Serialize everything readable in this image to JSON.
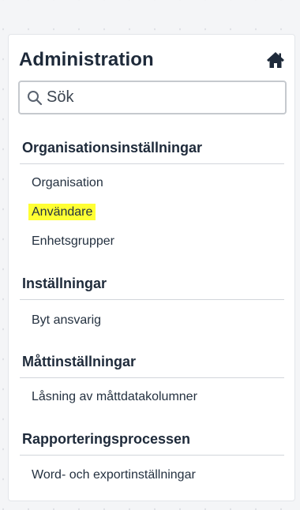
{
  "panel": {
    "title": "Administration",
    "home_icon": "home-icon"
  },
  "search": {
    "placeholder": "Sök",
    "value": "",
    "icon": "search-icon"
  },
  "sections": [
    {
      "title": "Organisationsinställningar",
      "items": [
        {
          "label": "Organisation"
        },
        {
          "label": "Användare",
          "highlighted": true,
          "highlight_color": "#ffff33"
        },
        {
          "label": "Enhetsgrupper"
        }
      ]
    },
    {
      "title": "Inställningar",
      "items": [
        {
          "label": "Byt ansvarig"
        }
      ]
    },
    {
      "title": "Måttinställningar",
      "items": [
        {
          "label": "Låsning av måttdatakolumner"
        }
      ]
    },
    {
      "title": "Rapporteringsprocessen",
      "items": [
        {
          "label": "Word- och exportinställningar"
        }
      ]
    }
  ]
}
